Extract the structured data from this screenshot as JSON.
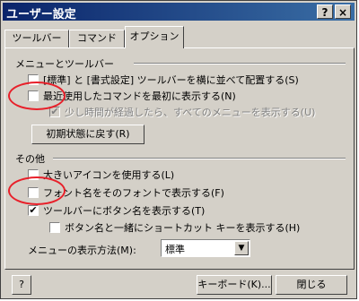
{
  "window": {
    "title": "ユーザー設定",
    "help_glyph": "?",
    "close_glyph": "×"
  },
  "tabs": [
    {
      "label": "ツールバー"
    },
    {
      "label": "コマンド"
    },
    {
      "label": "オプション"
    }
  ],
  "menus_group": {
    "label": "メニューとツールバー",
    "options": [
      {
        "label": "[標準] と [書式設定] ツールバーを横に並べて配置する(S)",
        "checked": false,
        "mark": ""
      },
      {
        "label": "最近使用したコマンドを最初に表示する(N)",
        "checked": false,
        "mark": ""
      },
      {
        "label": "少し時間が経過したら、すべてのメニューを表示する(U)",
        "checked": true,
        "mark": "✔"
      }
    ],
    "reset_button": "初期状態に戻す(R)"
  },
  "other_group": {
    "label": "その他",
    "options": [
      {
        "label": "大きいアイコンを使用する(L)",
        "checked": false,
        "mark": ""
      },
      {
        "label": "フォント名をそのフォントで表示する(F)",
        "checked": false,
        "mark": ""
      },
      {
        "label": "ツールバーにボタン名を表示する(T)",
        "checked": true,
        "mark": "✔"
      },
      {
        "label": "ボタン名と一緒にショートカット キーを表示する(H)",
        "checked": false,
        "mark": ""
      }
    ],
    "menu_animation": {
      "label": "メニューの表示方法(M):",
      "value": "標準",
      "arrow_glyph": "▼"
    }
  },
  "footer": {
    "help_glyph": "?",
    "keyboard_button": "キーボード(K)...",
    "close_button": "閉じる"
  },
  "colors": {
    "annotation_circle": "#e8202a",
    "title_bar": "#0a246a",
    "dialog_face": "#d4d0c8"
  }
}
